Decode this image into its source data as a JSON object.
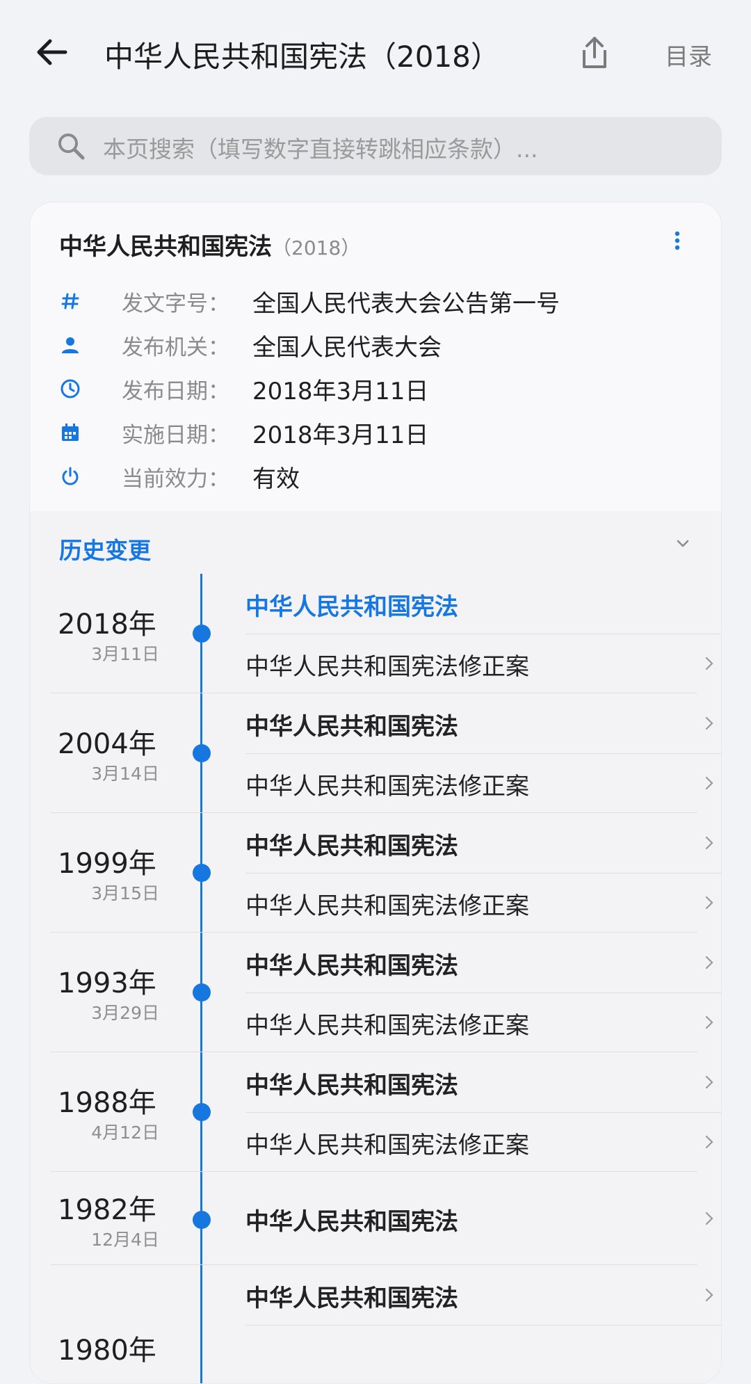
{
  "header": {
    "title": "中华人民共和国宪法（2018）",
    "toc_label": "目录"
  },
  "search": {
    "placeholder": "本页搜索（填写数字直接转跳相应条款）..."
  },
  "card": {
    "title": "中华人民共和国宪法",
    "year": "（2018）",
    "meta": [
      {
        "icon": "hash-icon",
        "label": "发文字号：",
        "value": "全国人民代表大会公告第一号"
      },
      {
        "icon": "person-icon",
        "label": "发布机关：",
        "value": "全国人民代表大会"
      },
      {
        "icon": "clock-icon",
        "label": "发布日期：",
        "value": "2018年3月11日"
      },
      {
        "icon": "calendar-icon",
        "label": "实施日期：",
        "value": "2018年3月11日"
      },
      {
        "icon": "power-icon",
        "label": "当前效力：",
        "value": "有效"
      }
    ]
  },
  "history": {
    "title": "历史变更",
    "groups": [
      {
        "year": "2018年",
        "date": "3月11日",
        "items": [
          {
            "label": "中华人民共和国宪法",
            "style": "active"
          },
          {
            "label": "中华人民共和国宪法修正案",
            "style": "normal"
          }
        ]
      },
      {
        "year": "2004年",
        "date": "3月14日",
        "items": [
          {
            "label": "中华人民共和国宪法",
            "style": "bold"
          },
          {
            "label": "中华人民共和国宪法修正案",
            "style": "normal"
          }
        ]
      },
      {
        "year": "1999年",
        "date": "3月15日",
        "items": [
          {
            "label": "中华人民共和国宪法",
            "style": "bold"
          },
          {
            "label": "中华人民共和国宪法修正案",
            "style": "normal"
          }
        ]
      },
      {
        "year": "1993年",
        "date": "3月29日",
        "items": [
          {
            "label": "中华人民共和国宪法",
            "style": "bold"
          },
          {
            "label": "中华人民共和国宪法修正案",
            "style": "normal"
          }
        ]
      },
      {
        "year": "1988年",
        "date": "4月12日",
        "items": [
          {
            "label": "中华人民共和国宪法",
            "style": "bold"
          },
          {
            "label": "中华人民共和国宪法修正案",
            "style": "normal"
          }
        ]
      },
      {
        "year": "1982年",
        "date": "12月4日",
        "items": [
          {
            "label": "中华人民共和国宪法",
            "style": "bold"
          }
        ]
      },
      {
        "year": "1980年",
        "date": "",
        "items": [
          {
            "label": "中华人民共和国宪法",
            "style": "bold"
          }
        ]
      }
    ]
  }
}
